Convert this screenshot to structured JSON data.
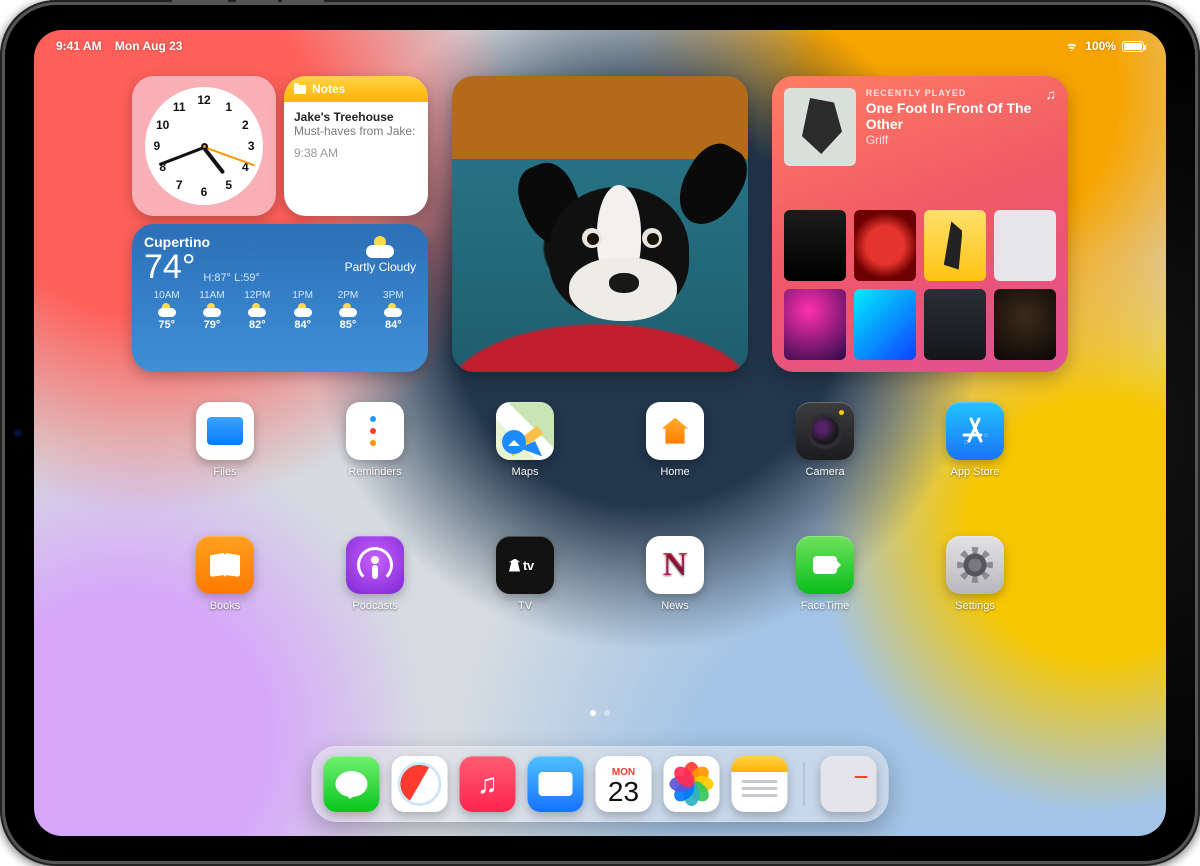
{
  "status": {
    "time": "9:41 AM",
    "date": "Mon Aug 23",
    "battery": "100%"
  },
  "widgets": {
    "clock": {
      "numerals": [
        "12",
        "1",
        "2",
        "3",
        "4",
        "5",
        "6",
        "7",
        "8",
        "9",
        "10",
        "11"
      ]
    },
    "notes": {
      "header": "Notes",
      "title": "Jake's Treehouse",
      "line": "Must-haves from Jake:",
      "time": "9:38 AM"
    },
    "weather": {
      "city": "Cupertino",
      "temp": "74°",
      "hilo": "H:87° L:59°",
      "condition": "Partly Cloudy",
      "hours": [
        {
          "h": "10AM",
          "t": "75°"
        },
        {
          "h": "11AM",
          "t": "79°"
        },
        {
          "h": "12PM",
          "t": "82°"
        },
        {
          "h": "1PM",
          "t": "84°"
        },
        {
          "h": "2PM",
          "t": "85°"
        },
        {
          "h": "3PM",
          "t": "84°"
        }
      ]
    },
    "music": {
      "label": "RECENTLY PLAYED",
      "song": "One Foot In Front Of The Other",
      "artist": "Griff"
    }
  },
  "apps": {
    "row1": [
      "Files",
      "Reminders",
      "Maps",
      "Home",
      "Camera",
      "App Store"
    ],
    "row2": [
      "Books",
      "Podcasts",
      "TV",
      "News",
      "FaceTime",
      "Settings"
    ]
  },
  "calendar": {
    "dow": "MON",
    "dom": "23"
  },
  "tv_label": "tv"
}
